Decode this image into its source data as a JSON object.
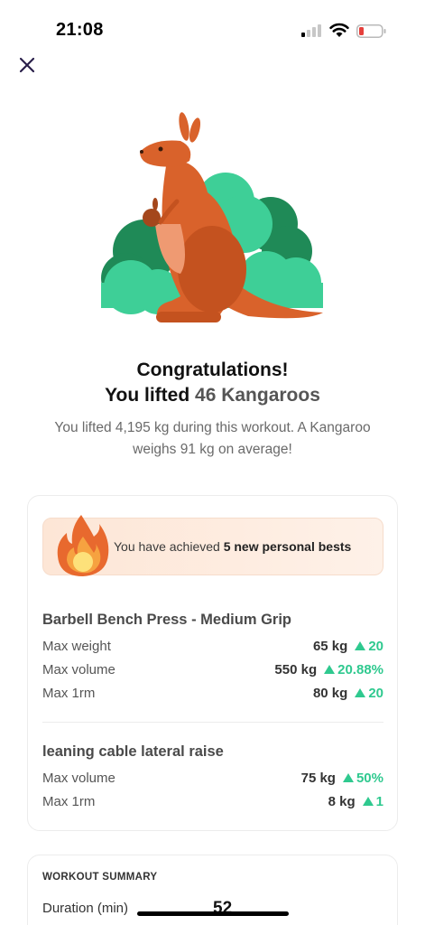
{
  "status_bar": {
    "time": "21:08"
  },
  "header": {
    "close_icon": "close-icon"
  },
  "hero": {
    "illustration": "kangaroo-illustration",
    "colors": {
      "kangaroo": "#d9622b",
      "bush_dark": "#1f8a57",
      "bush_light": "#3ecf97"
    }
  },
  "congrats": {
    "title": "Congratulations!",
    "lifted_prefix": "You lifted ",
    "lifted_highlight": "46 Kangaroos",
    "subtext": "You lifted 4,195 kg during this workout. A Kangaroo weighs 91 kg on average!"
  },
  "personal_bests": {
    "banner_prefix": "You have achieved ",
    "banner_bold": "5 new personal bests",
    "flame_icon": "flame-icon",
    "exercises": [
      {
        "name": "Barbell Bench Press - Medium Grip",
        "rows": [
          {
            "label": "Max weight",
            "value": "65 kg",
            "delta": "20"
          },
          {
            "label": "Max volume",
            "value": "550 kg",
            "delta": "20.88%"
          },
          {
            "label": "Max 1rm",
            "value": "80 kg",
            "delta": "20"
          }
        ]
      },
      {
        "name": "leaning cable lateral raise",
        "rows": [
          {
            "label": "Max volume",
            "value": "75 kg",
            "delta": "50%"
          },
          {
            "label": "Max 1rm",
            "value": "8 kg",
            "delta": "1"
          }
        ]
      }
    ],
    "colors": {
      "increase": "#2fc98f"
    }
  },
  "workout_summary": {
    "title": "WORKOUT SUMMARY",
    "duration_label": "Duration (min)",
    "duration_value": "52"
  }
}
